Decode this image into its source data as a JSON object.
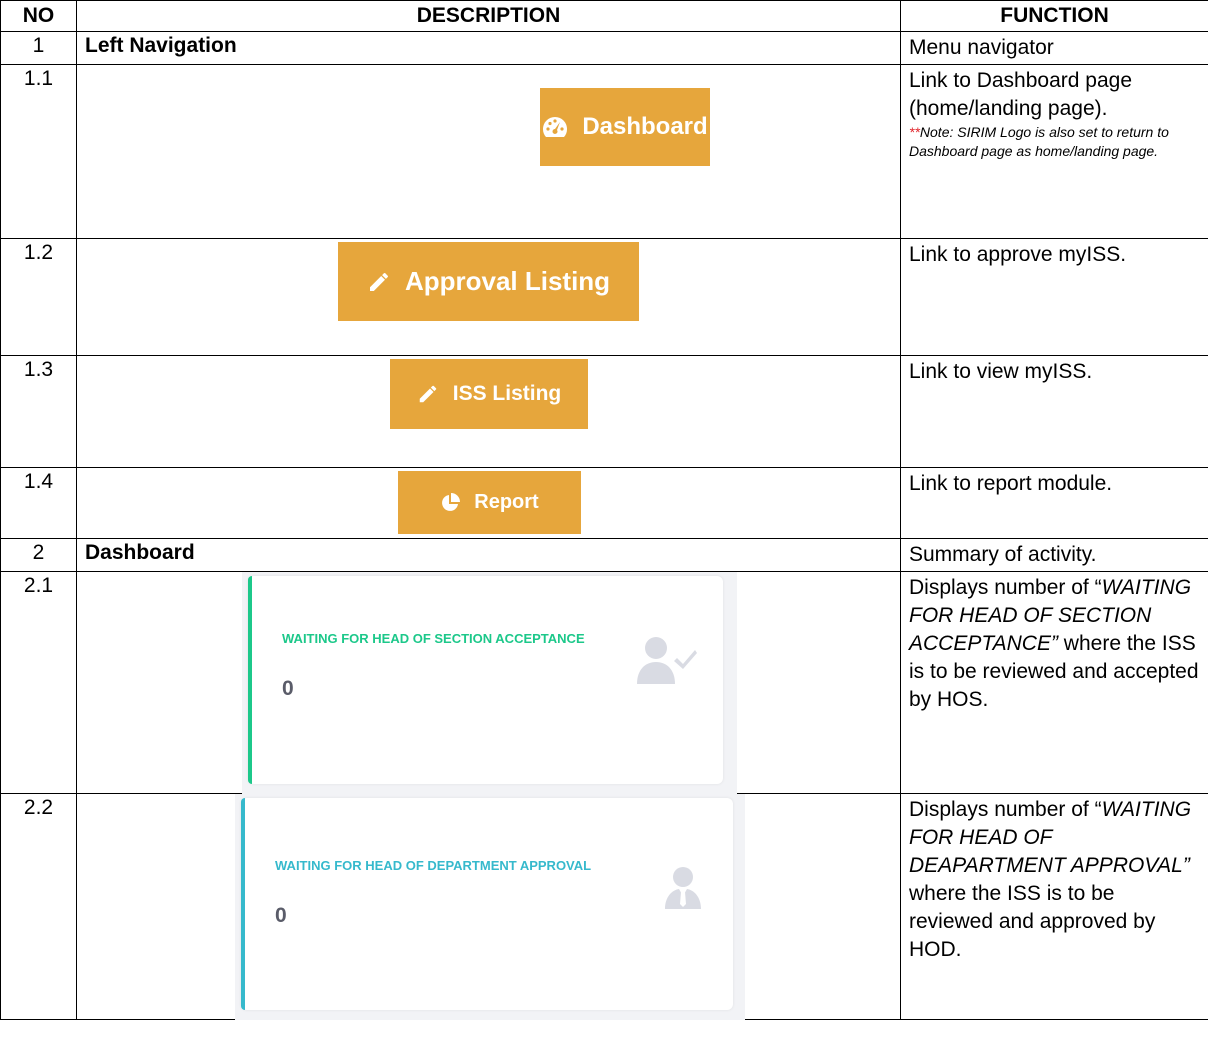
{
  "headers": {
    "no": "NO",
    "description": "DESCRIPTION",
    "function": "FUNCTION"
  },
  "rows": {
    "r1": {
      "no": "1",
      "description": "Left Navigation",
      "function": "Menu navigator"
    },
    "r1_1": {
      "no": "1.1",
      "button_label": "Dashboard",
      "button_icon": "tachometer-icon",
      "function": "Link to Dashboard page (home/landing page).",
      "note_stars": "**",
      "note_text": "Note: SIRIM Logo is also set to return to Dashboard page as home/landing page."
    },
    "r1_2": {
      "no": "1.2",
      "button_label": "Approval Listing",
      "button_icon": "pencil-icon",
      "function": "Link to approve myISS."
    },
    "r1_3": {
      "no": "1.3",
      "button_label": "ISS Listing",
      "button_icon": "pencil-icon",
      "function": "Link to view myISS."
    },
    "r1_4": {
      "no": "1.4",
      "button_label": "Report",
      "button_icon": "pie-chart-icon",
      "function": "Link to report module."
    },
    "r2": {
      "no": "2",
      "description": "Dashboard",
      "function": "Summary of activity."
    },
    "r2_1": {
      "no": "2.1",
      "card_title": "WAITING FOR HEAD OF SECTION ACCEPTANCE",
      "card_value": "0",
      "card_icon": "user-check-icon",
      "func_pre": "Displays number of “",
      "func_italic": "WAITING FOR HEAD OF SECTION ACCEPTANCE”",
      "func_post": " where the ISS is to be reviewed and accepted by HOS."
    },
    "r2_2": {
      "no": "2.2",
      "card_title": "WAITING FOR HEAD OF DEPARTMENT APPROVAL",
      "card_value": "0",
      "card_icon": "user-tie-icon",
      "func_pre": "Displays number of “",
      "func_italic": "WAITING FOR HEAD OF DEAPARTMENT APPROVAL”",
      "func_post": " where the ISS is to be reviewed and approved by HOD."
    }
  },
  "colors": {
    "button": "#e6a63c",
    "card1_accent": "#1cc88a",
    "card2_accent": "#36b9cc",
    "note_stars": "#e0252b"
  }
}
